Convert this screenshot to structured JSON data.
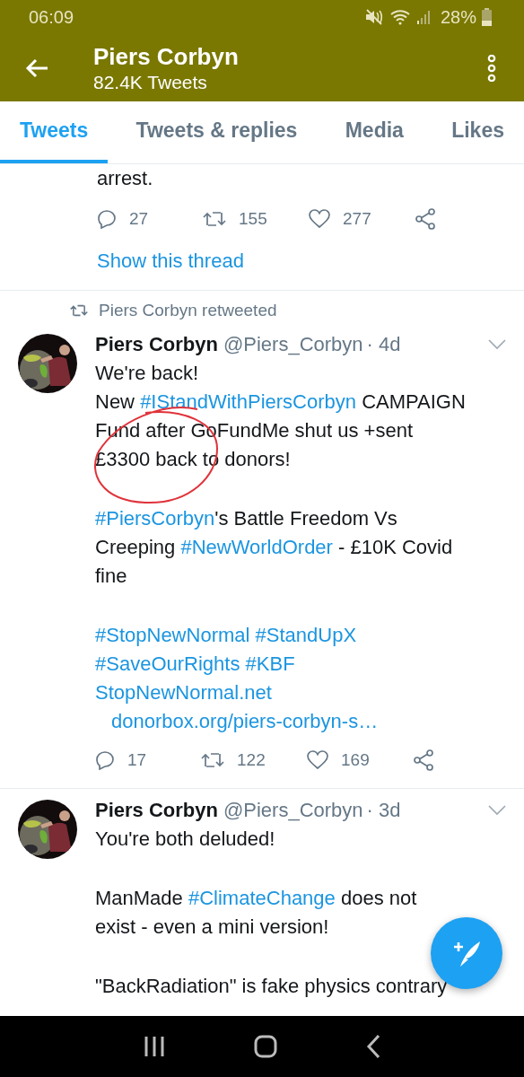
{
  "status_bar": {
    "time": "06:09",
    "battery": "28%"
  },
  "header": {
    "title": "Piers Corbyn",
    "subtitle": "82.4K Tweets"
  },
  "tabs": [
    {
      "label": "Tweets",
      "selected": true
    },
    {
      "label": "Tweets & replies",
      "selected": false
    },
    {
      "label": "Media",
      "selected": false
    },
    {
      "label": "Likes",
      "selected": false
    }
  ],
  "tweets": [
    {
      "kind": "fragment",
      "paragraphs": [
        [
          [
            {
              "text": "arrest.",
              "hashtag": false
            }
          ]
        ]
      ],
      "actions": {
        "replies": "27",
        "retweets": "155",
        "likes": "277"
      },
      "thread_link": "Show this thread"
    },
    {
      "kind": "full",
      "retweeted_by": "Piers Corbyn retweeted",
      "name": "Piers Corbyn",
      "handle": "@Piers_Corbyn",
      "time": "· 4d",
      "circled": true,
      "paragraphs": [
        [
          [
            {
              "text": "We're back!",
              "hashtag": false
            }
          ],
          [
            {
              "text": "New ",
              "hashtag": false
            },
            {
              "text": "#IStandWithPiersCorbyn",
              "hashtag": true
            },
            {
              "text": " CAMPAIGN",
              "hashtag": false
            }
          ],
          [
            {
              "text": "Fund after GoFundMe shut us +sent",
              "hashtag": false
            }
          ],
          [
            {
              "text": "£3300 back to donors!",
              "hashtag": false
            }
          ]
        ],
        [
          [
            {
              "text": "#PiersCorbyn",
              "hashtag": true
            },
            {
              "text": "'s Battle Freedom Vs",
              "hashtag": false
            }
          ],
          [
            {
              "text": "Creeping ",
              "hashtag": false
            },
            {
              "text": "#NewWorldOrder",
              "hashtag": true
            },
            {
              "text": " - £10K Covid",
              "hashtag": false
            }
          ],
          [
            {
              "text": "fine",
              "hashtag": false
            }
          ]
        ],
        [
          [
            {
              "text": "#StopNewNormal",
              "hashtag": true
            },
            {
              "text": "#StandUpX",
              "hashtag": true
            }
          ],
          [
            {
              "text": "#SaveOurRights",
              "hashtag": true
            },
            {
              "text": "#KBF",
              "hashtag": true
            }
          ],
          [
            {
              "text": "StopNewNormal.net",
              "hashtag": true
            }
          ]
        ]
      ],
      "card_link": "donorbox.org/piers-corbyn-s…",
      "actions": {
        "replies": "17",
        "retweets": "122",
        "likes": "169"
      }
    },
    {
      "kind": "full",
      "name": "Piers Corbyn",
      "handle": "@Piers_Corbyn",
      "time": "· 3d",
      "paragraphs": [
        [
          [
            {
              "text": "You're both deluded!",
              "hashtag": false
            }
          ]
        ],
        [
          [
            {
              "text": "ManMade ",
              "hashtag": false
            },
            {
              "text": "#ClimateChange",
              "hashtag": true
            },
            {
              "text": " does not",
              "hashtag": false
            }
          ],
          [
            {
              "text": "exist - even a mini version!",
              "hashtag": false
            }
          ]
        ],
        [
          [
            {
              "text": "\"BackRadiation\" is fake physics contrary",
              "hashtag": false
            }
          ]
        ]
      ]
    }
  ]
}
